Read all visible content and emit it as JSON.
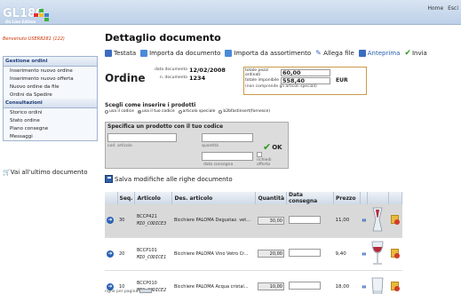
{
  "app": {
    "logo": "GL180",
    "tagline": "On Line Edition",
    "brand_colors": [
      "#e03030",
      "#f0c020",
      "#40b040",
      "#4080d0"
    ]
  },
  "header_links": [
    "Home",
    "Esci"
  ],
  "welcome": "Benvenuto USER8281 (122)",
  "sidebar": {
    "sections": [
      {
        "title": "Gestione ordini",
        "items": [
          "Inserimento nuovo ordine",
          "Inserimento nuovo offerta",
          "Nuovo ordine da file",
          "Ordini da Spedire"
        ]
      },
      {
        "title": "Consultazioni",
        "items": [
          "Storico ordini",
          "Stato ordine",
          "Piano consegne",
          "Messaggi"
        ]
      }
    ],
    "last_doc": "Vai all'ultimo documento"
  },
  "page": {
    "title": "Dettaglio documento",
    "toolbar": [
      {
        "label": "Testata",
        "icon": "document-icon"
      },
      {
        "label": "Importa da documento",
        "icon": "import-icon"
      },
      {
        "label": "Importa da assortimento",
        "icon": "import-icon"
      },
      {
        "label": "Allega file",
        "icon": "paperclip-icon"
      },
      {
        "label": "Anteprima",
        "icon": "preview-icon"
      },
      {
        "label": "Invia",
        "icon": "send-check-icon"
      }
    ]
  },
  "order": {
    "label": "Ordine",
    "date_label": "data documento",
    "date": "12/02/2008",
    "number_label": "n. documento",
    "number": "1234",
    "totals": {
      "pieces_label": "totale pezzi ordinati",
      "pieces": "60,00",
      "amount_label": "totale imponibile",
      "amount": "558,40",
      "currency": "EUR",
      "note": "(non comprende gli articoli speciali)"
    }
  },
  "choose": {
    "title": "Scegli come inserire i prodotti",
    "options": [
      "usa il codice",
      "usa il tuo codice",
      "articolo speciale",
      "b2bfastinsert(fornesce)"
    ],
    "selected_index": 1
  },
  "spec": {
    "title": "Specifica un prodotto con il tuo codice",
    "code_caption": "cod. articolo",
    "qty_caption": "quantità",
    "date_caption": "data consegna",
    "offer_caption": "richiedi offerta",
    "ok_label": "OK"
  },
  "save_label": "Salva modifiche alle righe documento",
  "table": {
    "headers": [
      "Seq.",
      "Articolo",
      "Des. articolo",
      "Quantità",
      "Data consegna",
      "Prezzo"
    ],
    "rows": [
      {
        "seq": "30",
        "code": "BCCP421",
        "mycode": "MIO_CODICE3",
        "desc": "Bicchiere PALOMA Degustaz. vet...",
        "qty": "30,00",
        "price": "11,00",
        "image": "hourglass-glass-icon"
      },
      {
        "seq": "20",
        "code": "BCCP101",
        "mycode": "MIO_CODICE1",
        "desc": "Bicchiere PALOMA Vino Vetro Cr...",
        "qty": "20,00",
        "price": "9,40",
        "image": "wine-glass-icon"
      },
      {
        "seq": "10",
        "code": "BCCP010",
        "mycode": "MIO_CODICE2",
        "desc": "Bicchiere PALOMA Acqua cristal...",
        "qty": "10,00",
        "price": "18,00",
        "image": "water-glass-icon"
      }
    ]
  },
  "footer_note": "righe per pagina"
}
